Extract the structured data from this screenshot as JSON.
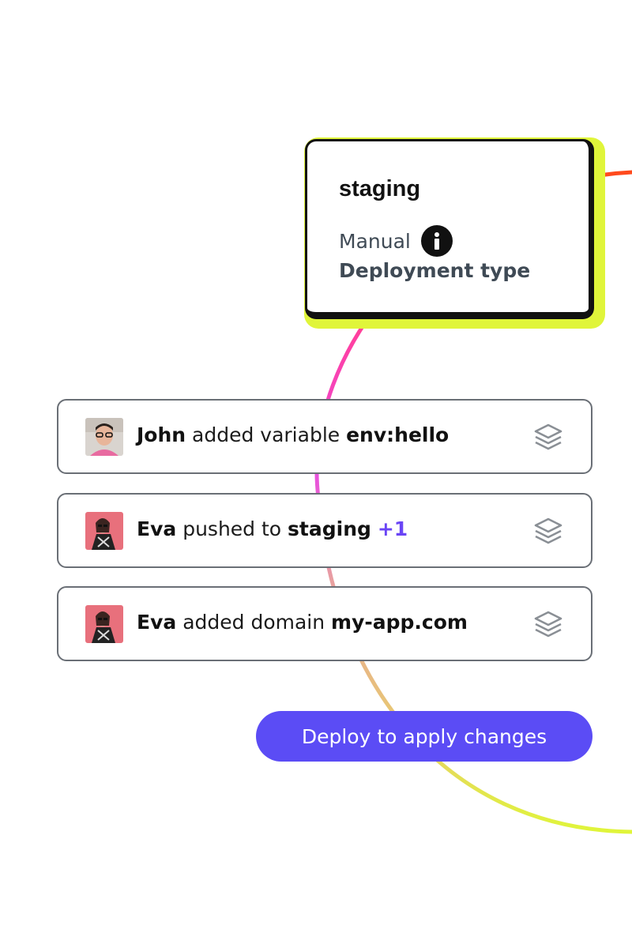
{
  "environment": {
    "name": "staging",
    "deploy_mode": "Manual",
    "deploy_type_label": "Deployment type",
    "icon": "info-icon"
  },
  "activity": [
    {
      "user": "John",
      "action": "added variable",
      "target": "env:hello",
      "extra": "",
      "avatar": "john-avatar",
      "icon": "layers-icon"
    },
    {
      "user": "Eva",
      "action": "pushed to",
      "target": "staging",
      "extra": "+1",
      "avatar": "eva-avatar",
      "icon": "layers-icon"
    },
    {
      "user": "Eva",
      "action": "added domain",
      "target": "my-app.com",
      "extra": "",
      "avatar": "eva-avatar",
      "icon": "layers-icon"
    }
  ],
  "cta": {
    "label": "Deploy to apply changes"
  },
  "colors": {
    "accent": "#5b4cf5",
    "card_highlight": "#e0f53a",
    "border": "#6a6f76",
    "extra_count": "#6a45f5"
  }
}
